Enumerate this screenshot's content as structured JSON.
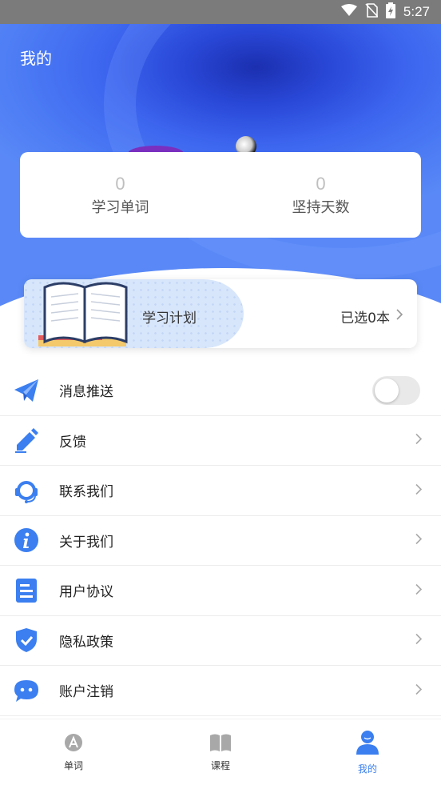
{
  "status_bar": {
    "time": "5:27",
    "icons": [
      "wifi-icon",
      "no-sim-icon",
      "battery-charging-icon"
    ]
  },
  "header": {
    "title": "我的"
  },
  "stats": [
    {
      "value": "0",
      "label": "学习单词"
    },
    {
      "value": "0",
      "label": "坚持天数"
    }
  ],
  "plan": {
    "title": "学习计划",
    "value": "已选0本"
  },
  "menu": [
    {
      "label": "消息推送",
      "icon": "paper-plane-icon",
      "control": "toggle",
      "toggle_on": false
    },
    {
      "label": "反馈",
      "icon": "pencil-icon",
      "control": "chevron"
    },
    {
      "label": "联系我们",
      "icon": "headset-support-icon",
      "control": "chevron"
    },
    {
      "label": "关于我们",
      "icon": "info-icon",
      "control": "chevron"
    },
    {
      "label": "用户协议",
      "icon": "document-icon",
      "control": "chevron"
    },
    {
      "label": "隐私政策",
      "icon": "shield-check-icon",
      "control": "chevron"
    },
    {
      "label": "账户注销",
      "icon": "chat-bubble-icon",
      "control": "chevron"
    }
  ],
  "tabs": [
    {
      "label": "单词",
      "icon": "letter-a-icon",
      "active": false
    },
    {
      "label": "课程",
      "icon": "open-book-icon",
      "active": false
    },
    {
      "label": "我的",
      "icon": "user-icon",
      "active": true
    }
  ],
  "colors": {
    "accent": "#3b7ff0",
    "hero": "#2a49d9",
    "icon_blue": "#3b7ff0"
  }
}
